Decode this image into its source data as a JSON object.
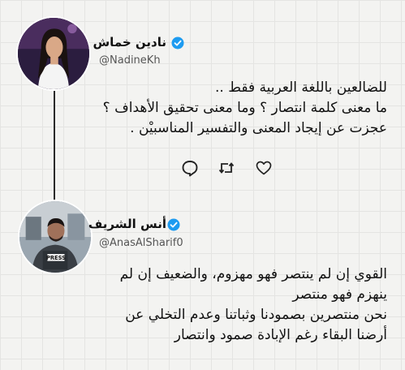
{
  "tweets": [
    {
      "name": "نادين خماش",
      "handle": "@NadineKh",
      "lines": [
        "للضالعين باللغة العربية فقط ..",
        "ما معنى كلمة انتصار ؟ وما معنى تحقيق الأهداف ؟",
        "عجزت عن إيجاد المعنى والتفسير المناسبيْن ."
      ],
      "actions": [
        "reply-icon",
        "retweet-icon",
        "like-icon"
      ]
    },
    {
      "name": "أنس الشريف",
      "handle": "@AnasAlSharif0",
      "lines": [
        "القوي إن لم ينتصر فهو مهزوم، والضعيف إن لم",
        "ينهزم فهو منتصر",
        "نحن منتصرين بصمودنا وثباتنا وعدم التخلي عن",
        "أرضنا البقاء رغم الإبادة صمود وانتصار"
      ],
      "avatar_badge": "PRESS"
    }
  ],
  "colors": {
    "verified": "#1d9bf0",
    "background": "#f3f3f1",
    "thread_line": "#2a2a2a"
  }
}
